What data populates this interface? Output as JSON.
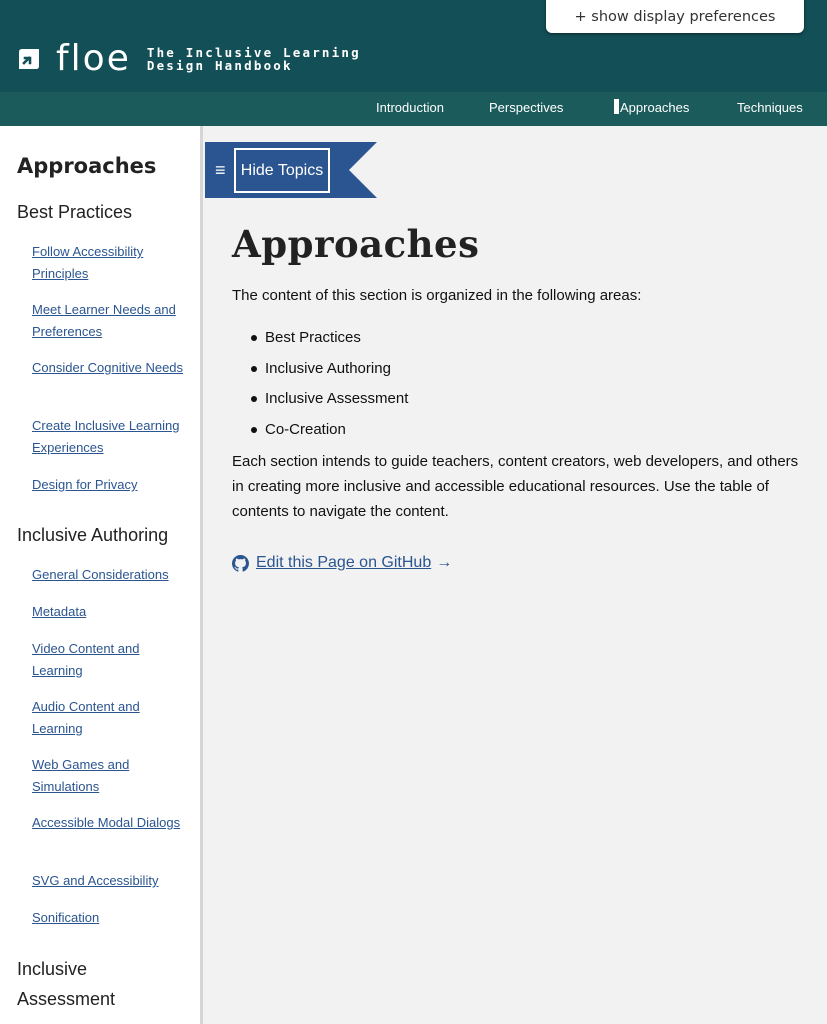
{
  "header": {
    "logo_word": "floe",
    "tagline_line1": "The Inclusive Learning",
    "tagline_line2": "Design Handbook",
    "prefs_button": "+ show display preferences"
  },
  "nav": {
    "items": [
      {
        "label": "Introduction",
        "active": false
      },
      {
        "label": "Perspectives",
        "active": false
      },
      {
        "label": "Approaches",
        "active": true
      },
      {
        "label": "Techniques",
        "active": false
      }
    ]
  },
  "sidebar": {
    "title": "Approaches",
    "sections": [
      {
        "label": "Best Practices",
        "links": [
          "Follow Accessibility Principles",
          "Meet Learner Needs and Preferences",
          "Consider Cognitive Needs",
          "Create Inclusive Learning Experiences",
          "Design for Privacy"
        ]
      },
      {
        "label": "Inclusive Authoring",
        "links": [
          "General Considerations",
          "Metadata",
          "Video Content and Learning",
          "Audio Content and Learning",
          "Web Games and Simulations",
          "Accessible Modal Dialogs",
          "SVG and Accessibility",
          "Sonification"
        ]
      },
      {
        "label": "Inclusive Assessment",
        "links": []
      }
    ]
  },
  "main": {
    "hide_topics_label": "Hide Topics",
    "title": "Approaches",
    "intro": "The content of this section is organized in the following areas:",
    "bullets": [
      "Best Practices",
      "Inclusive Authoring",
      "Inclusive Assessment",
      "Co-Creation"
    ],
    "paragraph": "Each section intends to guide teachers, content creators, web developers, and others in creating more inclusive and accessible educational resources. Use the table of contents to navigate the content.",
    "github_link": "Edit this Page on GitHub",
    "github_arrow": "→"
  },
  "colors": {
    "header_bg": "#124f56",
    "nav_bg": "#1b5b5b",
    "ribbon_bg": "#2b5590",
    "link": "#2b5590"
  }
}
